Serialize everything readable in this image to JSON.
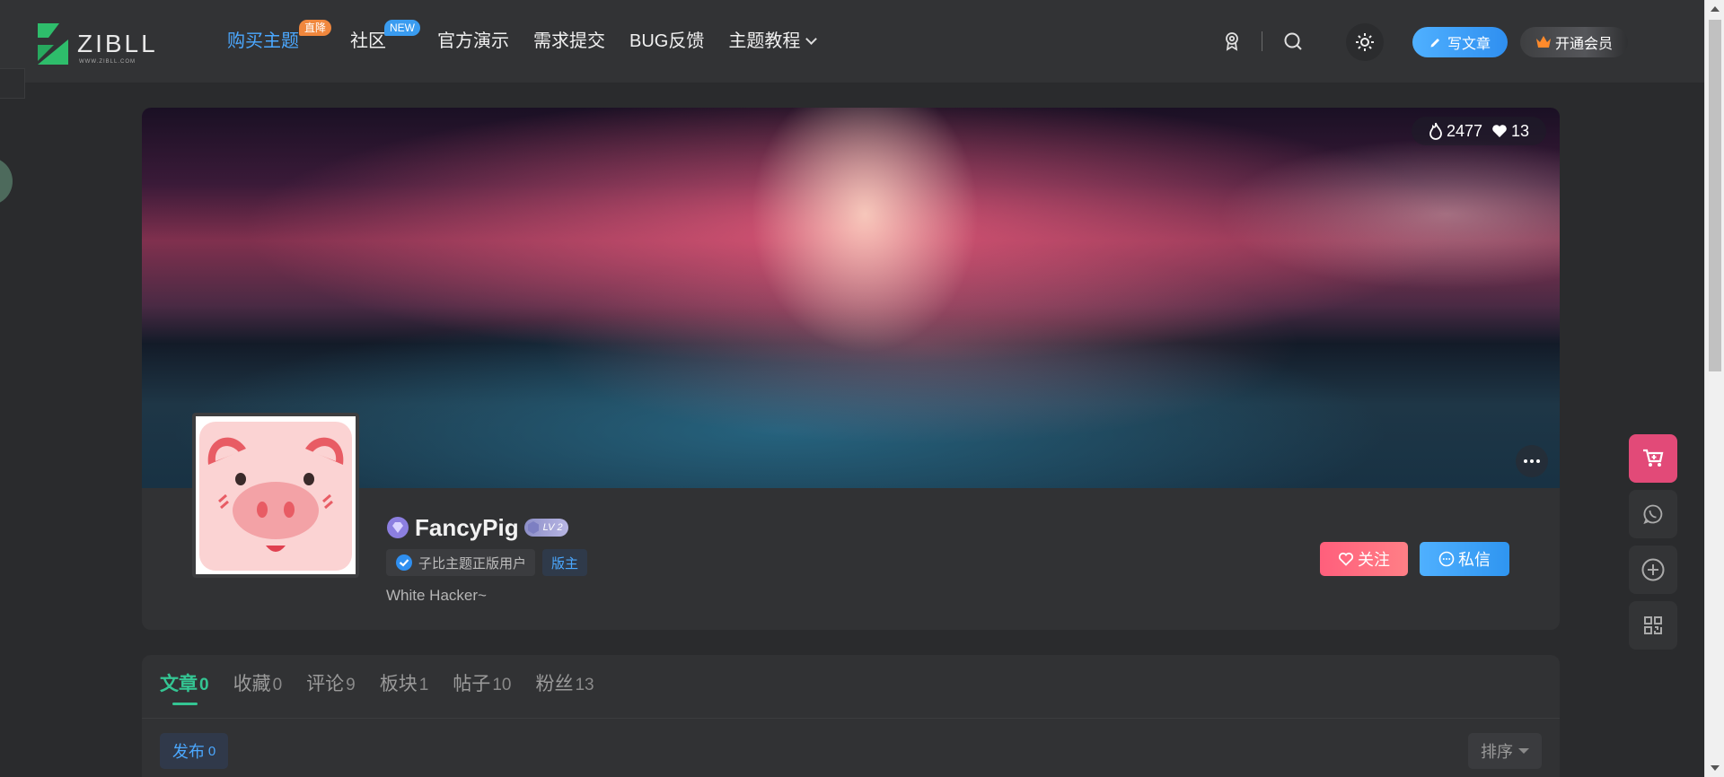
{
  "header": {
    "logo_text": "ZIBLL",
    "logo_sub": "WWW.ZIBLL.COM",
    "nav": [
      {
        "label": "购买主题",
        "badge": "直降"
      },
      {
        "label": "社区",
        "badge": "NEW"
      },
      {
        "label": "官方演示"
      },
      {
        "label": "需求提交"
      },
      {
        "label": "BUG反馈"
      },
      {
        "label": "主题教程"
      }
    ],
    "write_label": "写文章",
    "vip_label": "开通会员"
  },
  "profile": {
    "views": "2477",
    "likes": "13",
    "username": "FancyPig",
    "level": "LV 2",
    "tags": [
      "子比主题正版用户",
      "版主"
    ],
    "bio": "White Hacker~",
    "follow_label": "关注",
    "message_label": "私信"
  },
  "tabs": [
    {
      "label": "文章",
      "count": "0"
    },
    {
      "label": "收藏",
      "count": "0"
    },
    {
      "label": "评论",
      "count": "9"
    },
    {
      "label": "板块",
      "count": "1"
    },
    {
      "label": "帖子",
      "count": "10"
    },
    {
      "label": "粉丝",
      "count": "13"
    }
  ],
  "publish": {
    "label": "发布",
    "count": "0"
  },
  "sort_label": "排序",
  "colors": {
    "accent_blue": "#4ba8ff",
    "accent_green": "#34c593",
    "follow_pink": "#ff5f7c",
    "cart_pink": "#e24a78",
    "badge_orange": "#f0873d"
  },
  "icons": [
    "award-icon",
    "search-icon",
    "gear-icon",
    "pencil-icon",
    "crown-icon",
    "fire-icon",
    "heart-icon",
    "more-icon",
    "diamond-icon",
    "verified-icon",
    "chat-icon",
    "cart-icon",
    "whatsapp-icon",
    "plus-circle-icon",
    "qrcode-icon"
  ]
}
